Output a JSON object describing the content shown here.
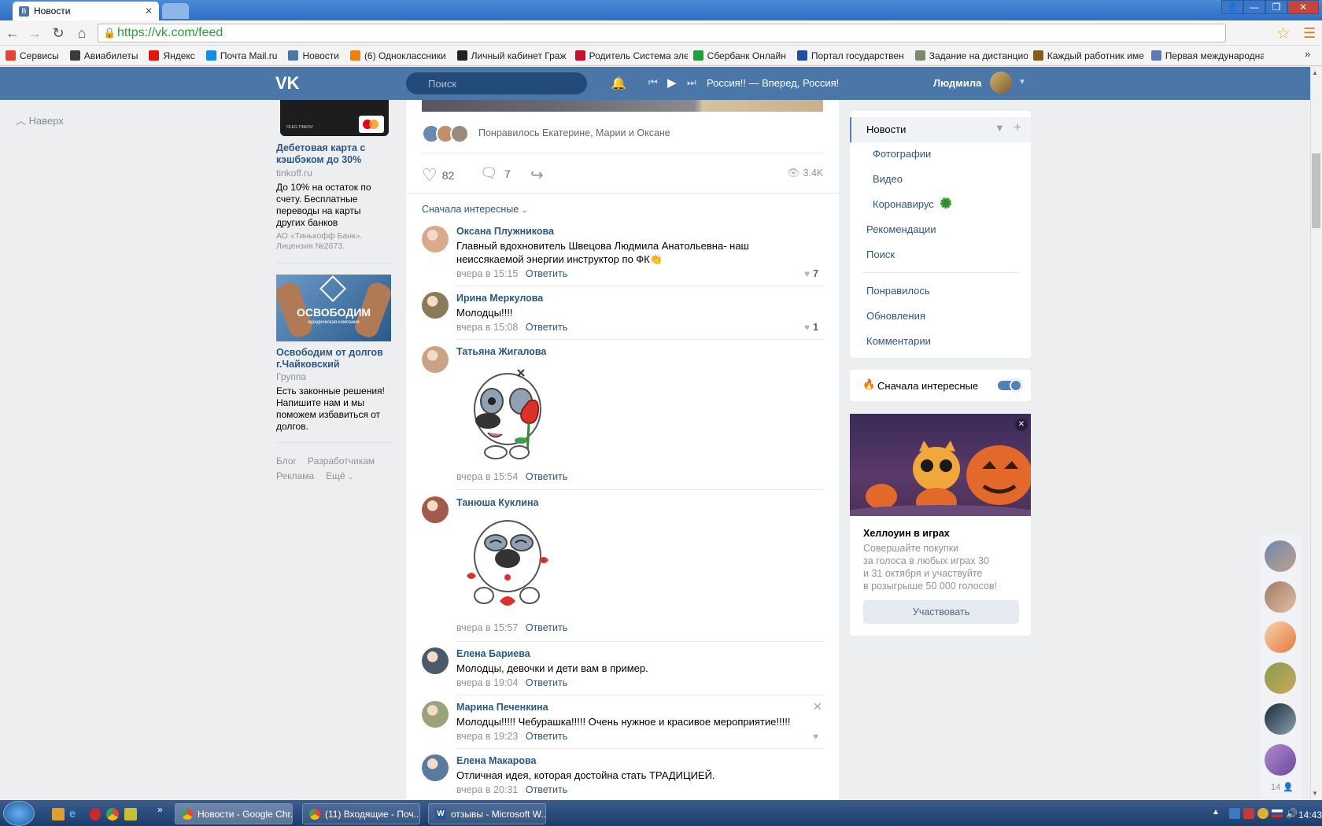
{
  "browser": {
    "tab_title": "Новости",
    "url": "https://vk.com/feed",
    "bookmarks": [
      {
        "label": "Сервисы",
        "color": "#e94235"
      },
      {
        "label": "Авиабилеты",
        "color": "#3a3a3a"
      },
      {
        "label": "Яндекс",
        "color": "#e61400"
      },
      {
        "label": "Почта Mail.ru",
        "color": "#168de2"
      },
      {
        "label": "Новости",
        "color": "#4a76a8"
      },
      {
        "label": "(6) Одноклассники",
        "color": "#ee8208"
      },
      {
        "label": "Личный кабинет Граж",
        "color": "#222222"
      },
      {
        "label": "Родитель Система эле",
        "color": "#c8102e"
      },
      {
        "label": "Сбербанк Онлайн",
        "color": "#21a038"
      },
      {
        "label": "Портал государствен",
        "color": "#1f4fa0"
      },
      {
        "label": "Задание на дистанцио",
        "color": "#7a8a6a"
      },
      {
        "label": "Каждый работник име",
        "color": "#8a5a1a"
      },
      {
        "label": "Первая международна",
        "color": "#5a7ab0"
      }
    ]
  },
  "header": {
    "search_placeholder": "Поиск",
    "now_playing": "Россия!! — Вперед, Россия!",
    "user_name": "Людмила"
  },
  "left": {
    "back_to_top": "Наверх",
    "ad1": {
      "title": "Дебетовая карта с кэшбэком до 30%",
      "domain": "tinkoff.ru",
      "text": "До 10% на остаток по счету. Бесплатные переводы на карты других банков",
      "legal": "АО «Тинькофф Банк». Лицензия №2673.",
      "card_caption": "OLEG TINKOV"
    },
    "ad2": {
      "image_caption": "ОСВОБОДИМ",
      "image_sub": "юридическая компания",
      "title": "Освободим от долгов г.Чайковский",
      "type": "Группа",
      "text": "Есть законные решения! Напишите нам и мы поможем избавиться от долгов."
    },
    "footer": [
      "Блог",
      "Разработчикам",
      "Реклама",
      "Ещё"
    ]
  },
  "post": {
    "liked_by": "Понравилось Екатерине, Марии и Оксане",
    "likes": "82",
    "comments": "7",
    "views": "3.4K",
    "sort_label": "Сначала интересные"
  },
  "comments": [
    {
      "name": "Оксана Плужникова",
      "text": "Главный вдохновитель Швецова Людмила Анатольевна- наш неиссякаемой энергии инструктор по ФК👏",
      "time": "вчера в 15:15",
      "reply": "Ответить",
      "likes": "7",
      "avatar": "#d9a98c"
    },
    {
      "name": "Ирина Меркулова",
      "text": "Молодцы!!!!",
      "time": "вчера в 15:08",
      "reply": "Ответить",
      "likes": "1",
      "avatar": "#8a7a5a"
    },
    {
      "name": "Татьяна Жигалова",
      "text": "",
      "time": "вчера в 15:54",
      "reply": "Ответить",
      "likes": "",
      "avatar": "#c9a384"
    },
    {
      "name": "Танюша Куклина",
      "text": "",
      "time": "вчера в 15:57",
      "reply": "Ответить",
      "likes": "",
      "avatar": "#a25a4a"
    },
    {
      "name": "Елена Бариева",
      "text": "Молодцы, девочки и дети вам в пример.",
      "time": "вчера в 19:04",
      "reply": "Ответить",
      "likes": "",
      "avatar": "#4a5a6a"
    },
    {
      "name": "Марина Печенкина",
      "text": "Молодцы!!!!! Чебурашка!!!!! Очень нужное и красивое мероприятие!!!!!",
      "time": "вчера в 19:23",
      "reply": "Ответить",
      "likes": "",
      "avatar": "#9aa27a"
    },
    {
      "name": "Елена Макарова",
      "text": "Отличная идея, которая достойна стать ТРАДИЦИЕЙ.",
      "time": "вчера в 20:31",
      "reply": "Ответить",
      "likes": "",
      "avatar": "#5a7aa0"
    }
  ],
  "right": {
    "menu": {
      "news": "Новости",
      "photos": "Фотографии",
      "video": "Видео",
      "corona": "Коронавирус",
      "recs": "Рекомендации",
      "search": "Поиск",
      "liked": "Понравилось",
      "updates": "Обновления",
      "comments": "Комментарии"
    },
    "toggle_label": "Сначала интересные",
    "promo": {
      "title": "Хеллоуин в играх",
      "text1": "Совершайте покупки",
      "text2": "за голоса в любых играх 30",
      "text3": "и 31 октября и участвуйте",
      "text4": "в розыгрыше 50 000 голосов!",
      "button": "Участвовать"
    }
  },
  "friends": {
    "count": "14"
  },
  "taskbar": {
    "tasks": [
      "Новости - Google Chr...",
      "(11) Входящие - Поч...",
      "отзывы - Microsoft W..."
    ],
    "clock": "14:43"
  }
}
